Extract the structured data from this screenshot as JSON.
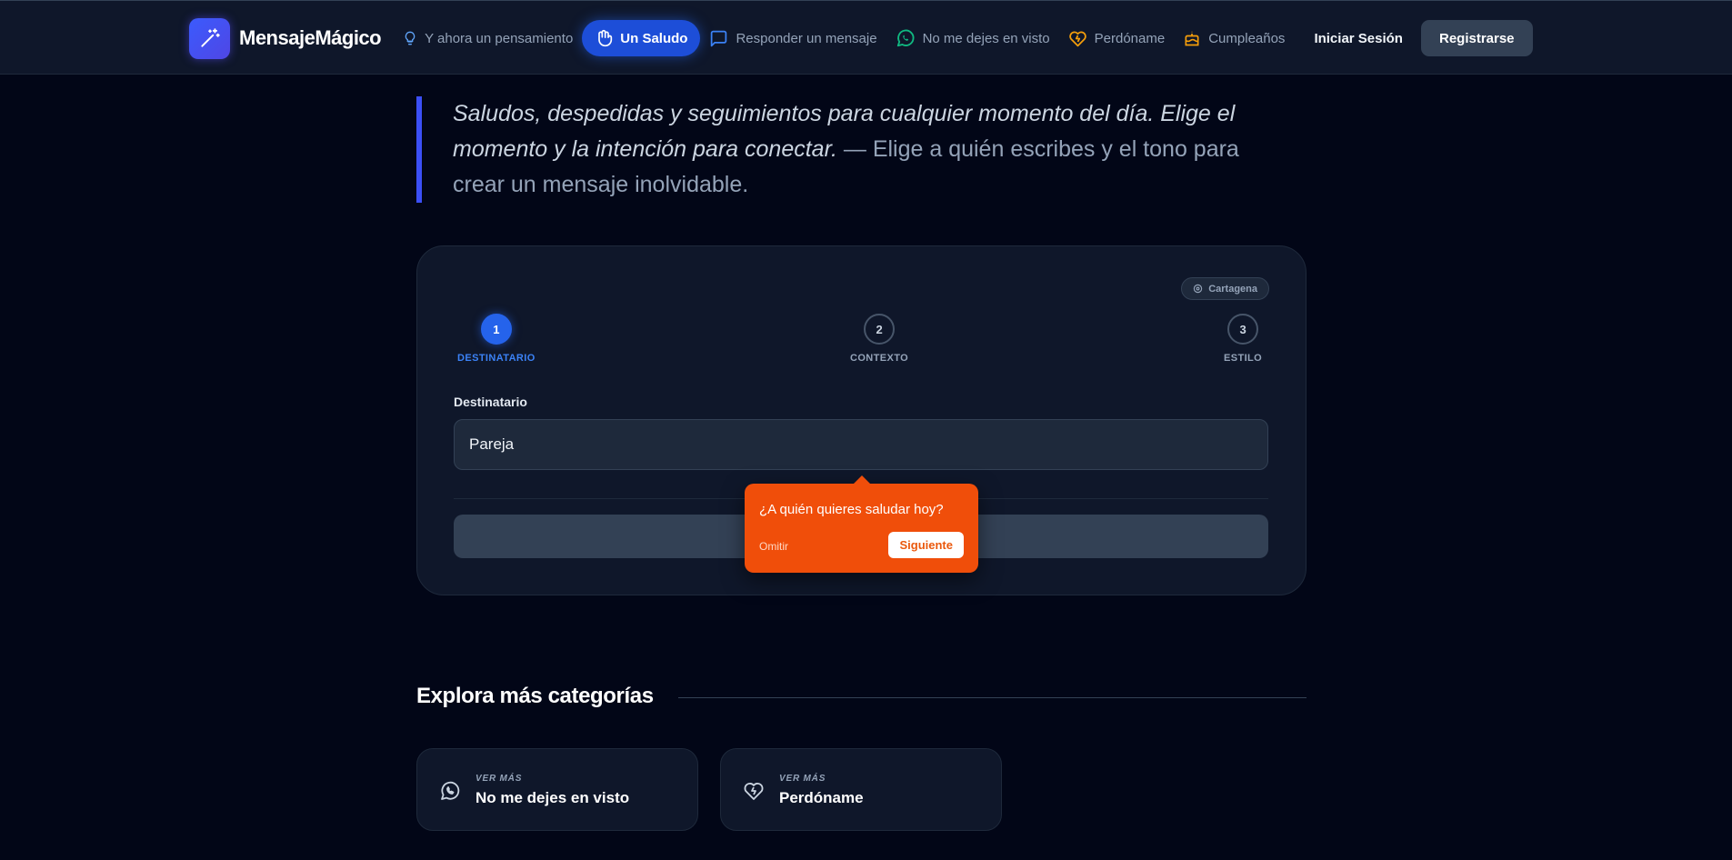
{
  "nav": {
    "brand": "MensajeMágico",
    "items": [
      {
        "label": "Y ahora un pensamiento",
        "icon": "lightbulb-icon"
      },
      {
        "label": "Un Saludo",
        "icon": "hand-wave-icon",
        "active": true
      },
      {
        "label": "Responder un mensaje",
        "icon": "chat-bubble-icon"
      },
      {
        "label": "No me dejes en visto",
        "icon": "whatsapp-icon"
      },
      {
        "label": "Perdóname",
        "icon": "broken-heart-icon"
      },
      {
        "label": "Cumpleaños",
        "icon": "cake-icon"
      }
    ],
    "login": "Iniciar Sesión",
    "register": "Registrarse"
  },
  "intro": {
    "emphasis": "Saludos, despedidas y seguimientos para cualquier momento del día. Elige el momento y la intención para conectar.",
    "rest": " — Elige a quién escribes y el tono para crear un mensaje inolvidable."
  },
  "wizard": {
    "location": "Cartagena",
    "steps": [
      {
        "number": "1",
        "label": "DESTINATARIO",
        "active": true
      },
      {
        "number": "2",
        "label": "CONTEXTO",
        "active": false
      },
      {
        "number": "3",
        "label": "ESTILO",
        "active": false
      }
    ],
    "field_label": "Destinatario",
    "field_value": "Pareja"
  },
  "tooltip": {
    "text": "¿A quién quieres saludar hoy?",
    "skip": "Omitir",
    "next": "Siguiente"
  },
  "explore": {
    "title": "Explora más categorías",
    "cards": [
      {
        "sub": "VER MÁS",
        "name": "No me dejes en visto",
        "icon": "whatsapp-icon"
      },
      {
        "sub": "VER MÁS",
        "name": "Perdóname",
        "icon": "broken-heart-icon"
      }
    ]
  },
  "colors": {
    "background": "#020617",
    "accent": "#2563eb",
    "tooltip": "#f04e0a",
    "whatsapp": "#10b981",
    "orange": "#f59e0b"
  }
}
